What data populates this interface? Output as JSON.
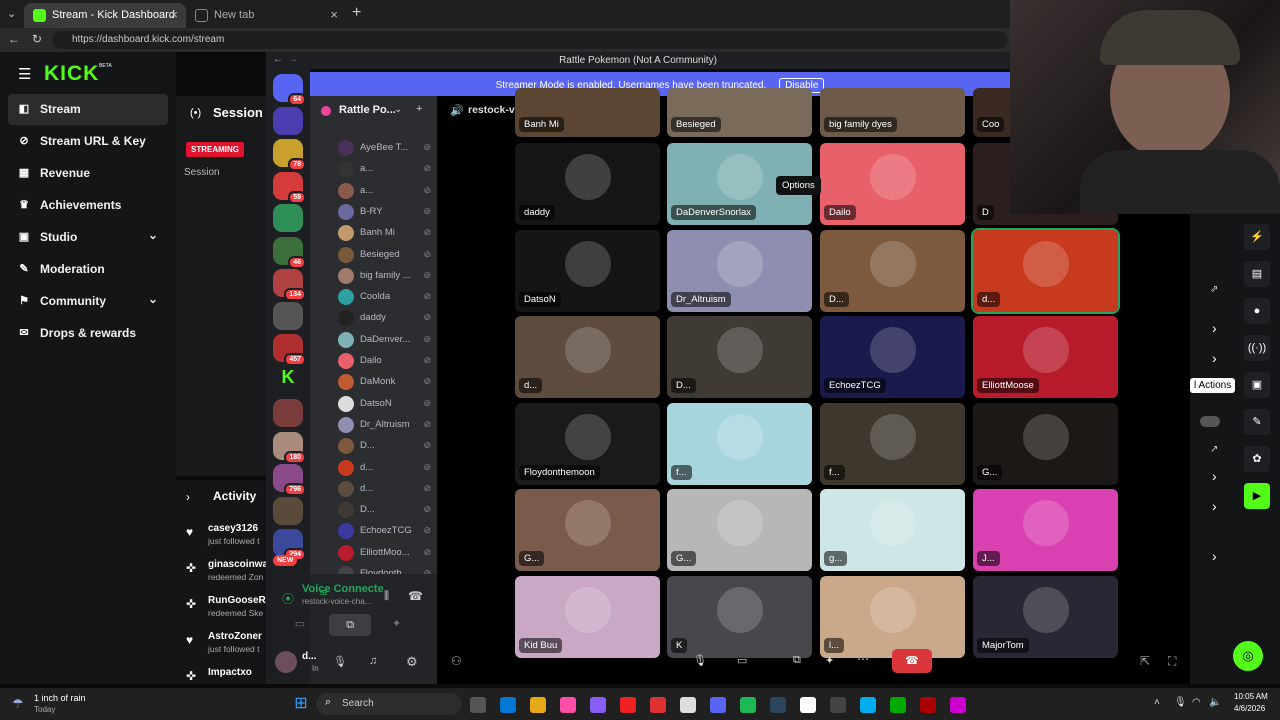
{
  "browser": {
    "tabs": [
      {
        "title": "Stream - Kick Dashboard",
        "active": true
      },
      {
        "title": "New tab",
        "active": false
      }
    ],
    "url": "https://dashboard.kick.com/stream"
  },
  "kick": {
    "logo": "KICK",
    "beta": "BETA",
    "nav": [
      {
        "label": "Stream",
        "icon": "stream-icon",
        "active": true
      },
      {
        "label": "Stream URL & Key",
        "icon": "link-icon"
      },
      {
        "label": "Revenue",
        "icon": "revenue-icon"
      },
      {
        "label": "Achievements",
        "icon": "trophy-icon"
      },
      {
        "label": "Studio",
        "icon": "studio-icon",
        "expandable": true
      },
      {
        "label": "Moderation",
        "icon": "wrench-icon"
      },
      {
        "label": "Community",
        "icon": "community-icon",
        "expandable": true
      },
      {
        "label": "Drops & rewards",
        "icon": "gift-icon"
      }
    ],
    "session_title": "Session",
    "streaming": "STREAMING",
    "session_label": "Session",
    "activity_title": "Activity",
    "activity": [
      {
        "user": "casey3126",
        "text": "just followed t",
        "icon": "heart-icon"
      },
      {
        "user": "ginascoinwa",
        "text": "redeemed Zon",
        "icon": "reward-icon"
      },
      {
        "user": "RunGooseRu",
        "text": "redeemed Ske",
        "icon": "reward-icon"
      },
      {
        "user": "AstroZoner",
        "text": "just followed t",
        "icon": "heart-icon"
      },
      {
        "user": "Impactxo",
        "text": "",
        "icon": "reward-icon"
      }
    ],
    "right_tooltip": "l Actions"
  },
  "discord": {
    "window_title": "Rattle Pokemon (Not A Community)",
    "streamer_banner": "Streamer Mode is enabled. Usernames have been truncated.",
    "disable_label": "Disable",
    "server_name": "Rattle Po...",
    "channel": "restock-voice-chat",
    "server_badges": [
      "64",
      "",
      "78",
      "59",
      "",
      "46",
      "134",
      "",
      "457",
      "",
      "",
      "180",
      "796",
      "",
      "294"
    ],
    "new_label": "NEW",
    "members": [
      "restock-vo...",
      "AyeBee T...",
      "a...",
      "a...",
      "B-RY",
      "Banh Mi",
      "Besieged",
      "big family ...",
      "Coolda",
      "daddy",
      "DaDenver...",
      "Dailo",
      "DaMonk",
      "DatsoN",
      "Dr_Altruism",
      "D...",
      "d...",
      "d...",
      "D...",
      "EchoezTCG",
      "ElliottMoo...",
      "Floydonth..."
    ],
    "voice_status": "Voice Connecte",
    "voice_channel": "restock-voice-cha...",
    "user_name": "d...",
    "user_status": "In",
    "tooltip": "Options",
    "tiles": [
      {
        "name": "Banh Mi",
        "bg": "#5a4632"
      },
      {
        "name": "Besieged",
        "bg": "#7a6a5a"
      },
      {
        "name": "big family dyes",
        "bg": "#6d5a48"
      },
      {
        "name": "Coo",
        "bg": "#3a2a22"
      },
      {
        "name": "daddy",
        "bg": "#161616"
      },
      {
        "name": "DaDenverSnorlax",
        "bg": "#7fb1b4"
      },
      {
        "name": "Dailo",
        "bg": "#e8606a"
      },
      {
        "name": "D",
        "bg": "#2a1f1c"
      },
      {
        "name": "DatsoN",
        "bg": "#151515"
      },
      {
        "name": "Dr_Altruism",
        "bg": "#8e8fb0"
      },
      {
        "name": "D...",
        "bg": "#7d5a3d"
      },
      {
        "name": "d...",
        "bg": "#c83a1f"
      },
      {
        "name": "d...",
        "bg": "#5d4b3d"
      },
      {
        "name": "D...",
        "bg": "#3f3a34"
      },
      {
        "name": "EchoezTCG",
        "bg": "#1a1a4d"
      },
      {
        "name": "ElliottMoose",
        "bg": "#b81c2c"
      },
      {
        "name": "Floydonthemoon",
        "bg": "#1a1a1a"
      },
      {
        "name": "f...",
        "bg": "#a7d5de"
      },
      {
        "name": "f...",
        "bg": "#3d372d"
      },
      {
        "name": "G...",
        "bg": "#1c1815"
      },
      {
        "name": "G...",
        "bg": "#7a5a4a"
      },
      {
        "name": "G...",
        "bg": "#b7b7b7"
      },
      {
        "name": "g...",
        "bg": "#cfe6e6"
      },
      {
        "name": "J...",
        "bg": "#d940b0"
      },
      {
        "name": "Kid Buu",
        "bg": "#c9a8c6"
      },
      {
        "name": "K",
        "bg": "#47474d"
      },
      {
        "name": "l...",
        "bg": "#caa98a"
      },
      {
        "name": "MajorTom",
        "bg": "#2a2633"
      }
    ]
  },
  "taskbar": {
    "weather": "1 inch of rain",
    "weather_sub": "Today",
    "search": "Search",
    "time": "10:05 AM",
    "date": "4/6/2026"
  }
}
